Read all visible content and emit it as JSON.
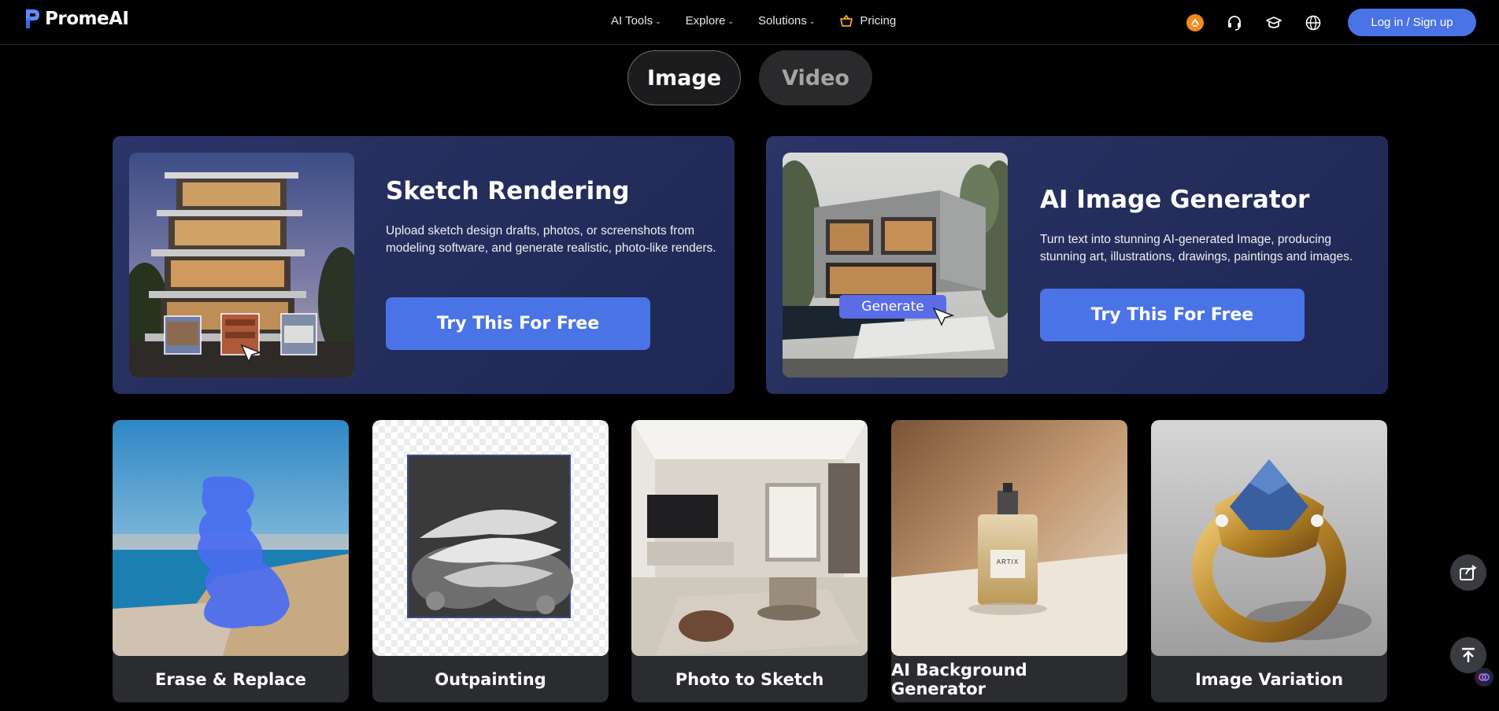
{
  "brand": {
    "name": "PromeAI"
  },
  "nav": {
    "items": [
      {
        "label": "AI Tools"
      },
      {
        "label": "Explore"
      },
      {
        "label": "Solutions"
      }
    ],
    "pricing": "Pricing",
    "login": "Log in / Sign up"
  },
  "tabs": {
    "image": "Image",
    "video": "Video",
    "active": "Image"
  },
  "features": [
    {
      "title": "Sketch Rendering",
      "description": "Upload sketch design drafts, photos, or screenshots from modeling software, and generate realistic, photo-like renders.",
      "button": "Try This For Free"
    },
    {
      "title": "AI Image Generator",
      "description": "Turn text into stunning AI-generated Image, producing stunning art, illustrations, drawings, paintings and images.",
      "button": "Try This For Free",
      "overlay_button": "Generate"
    }
  ],
  "tools": [
    {
      "label": "Erase & Replace"
    },
    {
      "label": "Outpainting"
    },
    {
      "label": "Photo to Sketch"
    },
    {
      "label": "AI Background Generator"
    },
    {
      "label": "Image Variation",
      "bottle_text": ""
    }
  ],
  "perfume_label": "ARTIX",
  "colors": {
    "accent": "#4a74e6",
    "card_bg": "#2b2c30",
    "feature_bg": "#262f60"
  }
}
